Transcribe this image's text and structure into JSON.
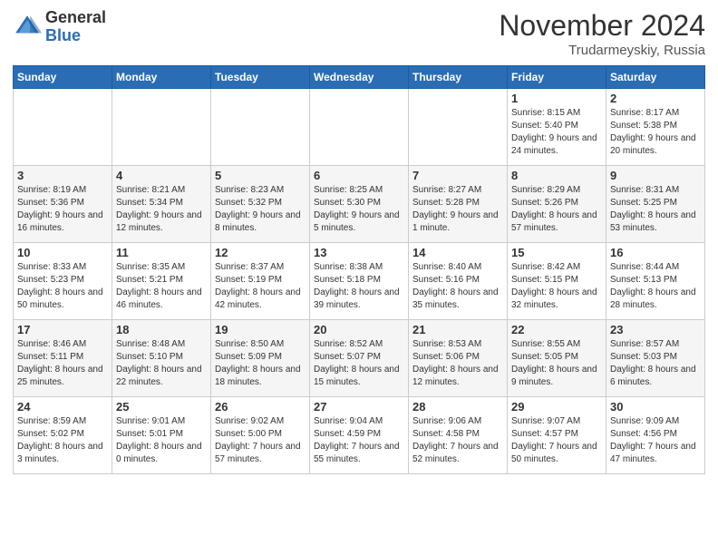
{
  "logo": {
    "general": "General",
    "blue": "Blue"
  },
  "header": {
    "month": "November 2024",
    "location": "Trudarmeyskiy, Russia"
  },
  "weekdays": [
    "Sunday",
    "Monday",
    "Tuesday",
    "Wednesday",
    "Thursday",
    "Friday",
    "Saturday"
  ],
  "weeks": [
    [
      {
        "day": "",
        "info": ""
      },
      {
        "day": "",
        "info": ""
      },
      {
        "day": "",
        "info": ""
      },
      {
        "day": "",
        "info": ""
      },
      {
        "day": "",
        "info": ""
      },
      {
        "day": "1",
        "info": "Sunrise: 8:15 AM\nSunset: 5:40 PM\nDaylight: 9 hours and 24 minutes."
      },
      {
        "day": "2",
        "info": "Sunrise: 8:17 AM\nSunset: 5:38 PM\nDaylight: 9 hours and 20 minutes."
      }
    ],
    [
      {
        "day": "3",
        "info": "Sunrise: 8:19 AM\nSunset: 5:36 PM\nDaylight: 9 hours and 16 minutes."
      },
      {
        "day": "4",
        "info": "Sunrise: 8:21 AM\nSunset: 5:34 PM\nDaylight: 9 hours and 12 minutes."
      },
      {
        "day": "5",
        "info": "Sunrise: 8:23 AM\nSunset: 5:32 PM\nDaylight: 9 hours and 8 minutes."
      },
      {
        "day": "6",
        "info": "Sunrise: 8:25 AM\nSunset: 5:30 PM\nDaylight: 9 hours and 5 minutes."
      },
      {
        "day": "7",
        "info": "Sunrise: 8:27 AM\nSunset: 5:28 PM\nDaylight: 9 hours and 1 minute."
      },
      {
        "day": "8",
        "info": "Sunrise: 8:29 AM\nSunset: 5:26 PM\nDaylight: 8 hours and 57 minutes."
      },
      {
        "day": "9",
        "info": "Sunrise: 8:31 AM\nSunset: 5:25 PM\nDaylight: 8 hours and 53 minutes."
      }
    ],
    [
      {
        "day": "10",
        "info": "Sunrise: 8:33 AM\nSunset: 5:23 PM\nDaylight: 8 hours and 50 minutes."
      },
      {
        "day": "11",
        "info": "Sunrise: 8:35 AM\nSunset: 5:21 PM\nDaylight: 8 hours and 46 minutes."
      },
      {
        "day": "12",
        "info": "Sunrise: 8:37 AM\nSunset: 5:19 PM\nDaylight: 8 hours and 42 minutes."
      },
      {
        "day": "13",
        "info": "Sunrise: 8:38 AM\nSunset: 5:18 PM\nDaylight: 8 hours and 39 minutes."
      },
      {
        "day": "14",
        "info": "Sunrise: 8:40 AM\nSunset: 5:16 PM\nDaylight: 8 hours and 35 minutes."
      },
      {
        "day": "15",
        "info": "Sunrise: 8:42 AM\nSunset: 5:15 PM\nDaylight: 8 hours and 32 minutes."
      },
      {
        "day": "16",
        "info": "Sunrise: 8:44 AM\nSunset: 5:13 PM\nDaylight: 8 hours and 28 minutes."
      }
    ],
    [
      {
        "day": "17",
        "info": "Sunrise: 8:46 AM\nSunset: 5:11 PM\nDaylight: 8 hours and 25 minutes."
      },
      {
        "day": "18",
        "info": "Sunrise: 8:48 AM\nSunset: 5:10 PM\nDaylight: 8 hours and 22 minutes."
      },
      {
        "day": "19",
        "info": "Sunrise: 8:50 AM\nSunset: 5:09 PM\nDaylight: 8 hours and 18 minutes."
      },
      {
        "day": "20",
        "info": "Sunrise: 8:52 AM\nSunset: 5:07 PM\nDaylight: 8 hours and 15 minutes."
      },
      {
        "day": "21",
        "info": "Sunrise: 8:53 AM\nSunset: 5:06 PM\nDaylight: 8 hours and 12 minutes."
      },
      {
        "day": "22",
        "info": "Sunrise: 8:55 AM\nSunset: 5:05 PM\nDaylight: 8 hours and 9 minutes."
      },
      {
        "day": "23",
        "info": "Sunrise: 8:57 AM\nSunset: 5:03 PM\nDaylight: 8 hours and 6 minutes."
      }
    ],
    [
      {
        "day": "24",
        "info": "Sunrise: 8:59 AM\nSunset: 5:02 PM\nDaylight: 8 hours and 3 minutes."
      },
      {
        "day": "25",
        "info": "Sunrise: 9:01 AM\nSunset: 5:01 PM\nDaylight: 8 hours and 0 minutes."
      },
      {
        "day": "26",
        "info": "Sunrise: 9:02 AM\nSunset: 5:00 PM\nDaylight: 7 hours and 57 minutes."
      },
      {
        "day": "27",
        "info": "Sunrise: 9:04 AM\nSunset: 4:59 PM\nDaylight: 7 hours and 55 minutes."
      },
      {
        "day": "28",
        "info": "Sunrise: 9:06 AM\nSunset: 4:58 PM\nDaylight: 7 hours and 52 minutes."
      },
      {
        "day": "29",
        "info": "Sunrise: 9:07 AM\nSunset: 4:57 PM\nDaylight: 7 hours and 50 minutes."
      },
      {
        "day": "30",
        "info": "Sunrise: 9:09 AM\nSunset: 4:56 PM\nDaylight: 7 hours and 47 minutes."
      }
    ]
  ]
}
